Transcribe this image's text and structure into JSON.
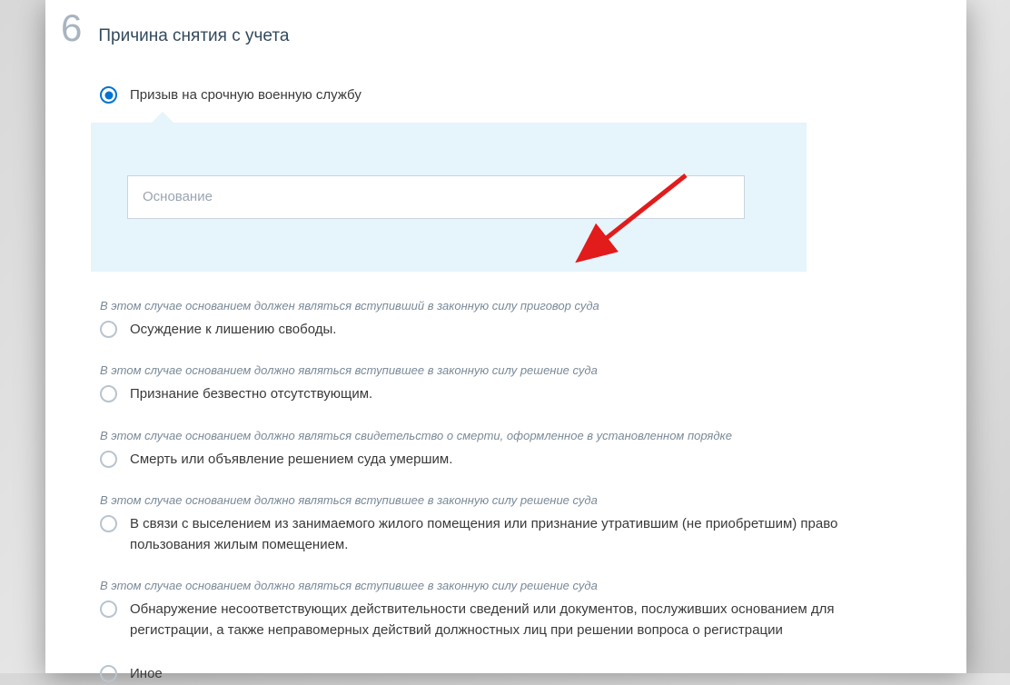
{
  "section": {
    "number": "6",
    "title": "Причина снятия с учета"
  },
  "options": [
    {
      "label": "Призыв на срочную военную службу",
      "hint": "",
      "selected": true
    },
    {
      "label": "Осуждение к лишению свободы.",
      "hint": "В этом случае основанием должен являться вступивший в законную силу приговор суда",
      "selected": false
    },
    {
      "label": "Признание безвестно отсутствующим.",
      "hint": "В этом случае основанием должно являться вступившее в законную силу решение суда",
      "selected": false
    },
    {
      "label": "Смерть или объявление решением суда умершим.",
      "hint": "В этом случае основанием должно являться свидетельство о смерти, оформленное в установленном порядке",
      "selected": false
    },
    {
      "label": "В связи с выселением из занимаемого жилого помещения или признание утратившим (не приобретшим) право пользования жилым помещением.",
      "hint": "В этом случае основанием должно являться вступившее в законную силу решение суда",
      "selected": false
    },
    {
      "label": "Обнаружение несоответствующих действительности сведений или документов, послуживших основанием для регистрации, а также неправомерных действий должностных лиц при решении вопроса о регистрации",
      "hint": "В этом случае основанием должно являться вступившее в законную силу решение суда",
      "selected": false
    },
    {
      "label": "Иное",
      "hint": "",
      "selected": false
    }
  ],
  "input": {
    "placeholder": "Основание",
    "value": ""
  }
}
